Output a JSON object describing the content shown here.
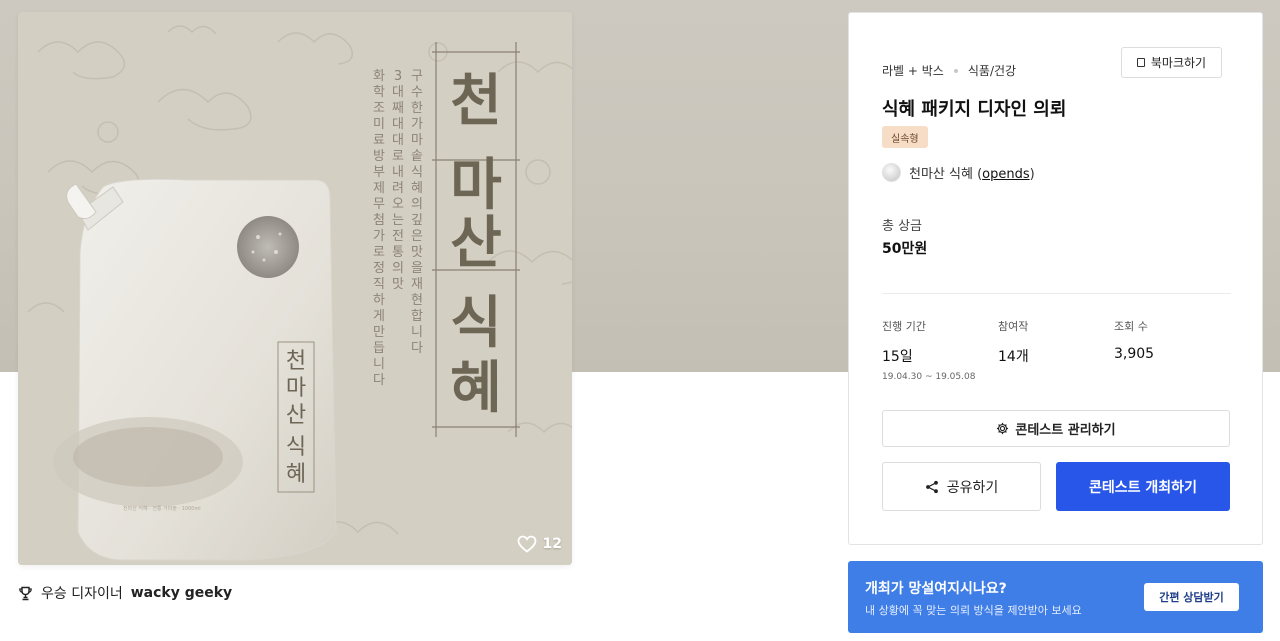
{
  "artwork": {
    "headline": "천마산 식혜",
    "copy_lines": [
      "구수한 가마솥식혜의 깊은 맛을 재현합니다",
      "3대째 대대로 내려오는 전통의 맛",
      "화학조미료 방부제 무첨가로 정직하게 만듭니다"
    ],
    "pouch_label": "천마산 식혜"
  },
  "image": {
    "likes": "12"
  },
  "award": {
    "prefix": "우승 디자이너",
    "designer": "wacky geeky"
  },
  "contest": {
    "category1": "라벨 + 박스",
    "category2": "식품/건강",
    "bookmark_label": "북마크하기",
    "title": "식혜 패키지 디자인 의뢰",
    "badge": "실속형",
    "host_name": "천마산 식혜 (",
    "host_id": "opends",
    "host_close": ")",
    "prize_label": "총 상금",
    "prize_value": "50만원",
    "stats": {
      "period_label": "진행 기간",
      "period_value": "15일",
      "period_range": "19.04.30 ~ 19.05.08",
      "entries_label": "참여작",
      "entries_value": "14개",
      "views_label": "조회 수",
      "views_value": "3,905"
    },
    "manage_label": "콘테스트 관리하기",
    "share_label": "공유하기",
    "host_contest_label": "콘테스트 개최하기"
  },
  "banner": {
    "title": "개최가 망설여지시나요?",
    "subtitle": "내 상황에 꼭 맞는 의뢰 방식을 제안받아 보세요",
    "button": "간편 상담받기"
  },
  "colors": {
    "primary_button": "#2856e8",
    "banner": "#3f7ee6",
    "badge_bg": "#f7dcc6"
  }
}
